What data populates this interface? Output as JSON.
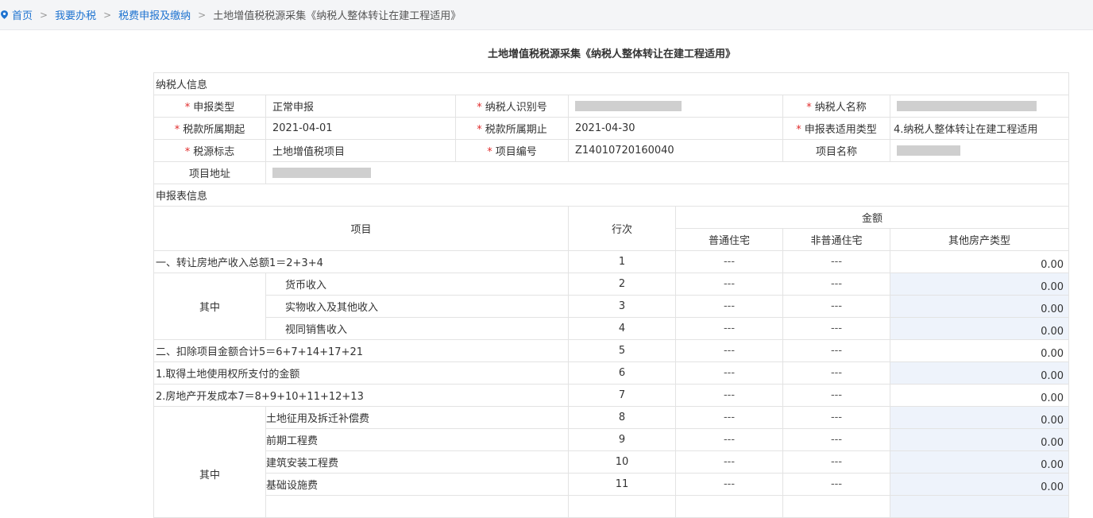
{
  "breadcrumb": {
    "home": "首页",
    "level1": "我要办税",
    "level2": "税费申报及缴纳",
    "current": "土地增值税税源采集《纳税人整体转让在建工程适用》",
    "separator": ">"
  },
  "title": "土地增值税税源采集《纳税人整体转让在建工程适用》",
  "taxpayer_section": {
    "heading": "纳税人信息",
    "required_mark": "*",
    "fields": {
      "declare_type": {
        "label": "申报类型",
        "value": "正常申报"
      },
      "taxpayer_id": {
        "label": "纳税人识别号",
        "value": ""
      },
      "taxpayer_name": {
        "label": "纳税人名称",
        "value": ""
      },
      "period_start": {
        "label": "税款所属期起",
        "value": "2021-04-01"
      },
      "period_end": {
        "label": "税款所属期止",
        "value": "2021-04-30"
      },
      "form_type": {
        "label": "申报表适用类型",
        "value": "4.纳税人整体转让在建工程适用"
      },
      "source_flag": {
        "label": "税源标志",
        "value": "土地增值税项目"
      },
      "project_no": {
        "label": "项目编号",
        "value": "Z14010720160040"
      },
      "project_name": {
        "label": "项目名称",
        "value": ""
      },
      "project_address": {
        "label": "项目地址",
        "value": ""
      }
    }
  },
  "report_section": {
    "heading": "申报表信息",
    "columns": {
      "item": "项目",
      "line": "行次",
      "amount": "金额",
      "ordinary": "普通住宅",
      "non_ordinary": "非普通住宅",
      "other": "其他房产类型"
    },
    "group_label": "其中",
    "rows": [
      {
        "item": "一、转让房地产收入总额1＝2+3+4",
        "line": "1",
        "ordinary": "---",
        "non_ordinary": "---",
        "other": "0.00"
      },
      {
        "item": "货币收入",
        "line": "2",
        "ordinary": "---",
        "non_ordinary": "---",
        "other": "0.00"
      },
      {
        "item": "实物收入及其他收入",
        "line": "3",
        "ordinary": "---",
        "non_ordinary": "---",
        "other": "0.00"
      },
      {
        "item": "视同销售收入",
        "line": "4",
        "ordinary": "---",
        "non_ordinary": "---",
        "other": "0.00"
      },
      {
        "item": "二、扣除项目金额合计5＝6+7+14+17+21",
        "line": "5",
        "ordinary": "---",
        "non_ordinary": "---",
        "other": "0.00"
      },
      {
        "item": "1.取得土地使用权所支付的金额",
        "line": "6",
        "ordinary": "---",
        "non_ordinary": "---",
        "other": "0.00"
      },
      {
        "item": "2.房地产开发成本7＝8+9+10+11+12+13",
        "line": "7",
        "ordinary": "---",
        "non_ordinary": "---",
        "other": "0.00"
      },
      {
        "item": "土地征用及拆迁补偿费",
        "line": "8",
        "ordinary": "---",
        "non_ordinary": "---",
        "other": "0.00"
      },
      {
        "item": "前期工程费",
        "line": "9",
        "ordinary": "---",
        "non_ordinary": "---",
        "other": "0.00"
      },
      {
        "item": "建筑安装工程费",
        "line": "10",
        "ordinary": "---",
        "non_ordinary": "---",
        "other": "0.00"
      },
      {
        "item": "基础设施费",
        "line": "11",
        "ordinary": "---",
        "non_ordinary": "---",
        "other": "0.00"
      }
    ]
  },
  "colors": {
    "link": "#1e73d0",
    "required": "#e02b2b",
    "editable_bg": "#eef3fb",
    "border": "#e3e3e3"
  }
}
